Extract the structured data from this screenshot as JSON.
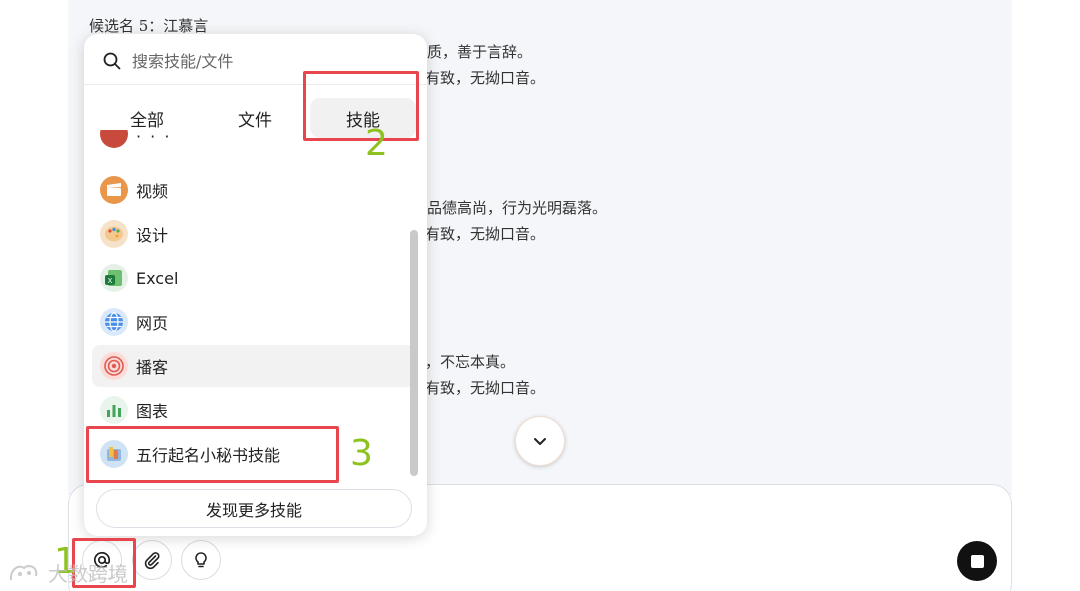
{
  "chat": {
    "lines": [
      "候选名 5：江慕言",
      "质，善于言辞。",
      "有致，无拗口音。",
      "品德高尚，行为光明磊落。",
      "有致，无拗口音。",
      "，不忘本真。",
      "有致，无拗口音。"
    ]
  },
  "popup": {
    "search_placeholder": "搜索技能/文件",
    "tabs": [
      {
        "label": "全部"
      },
      {
        "label": "文件"
      },
      {
        "label": "技能",
        "active": true
      }
    ],
    "cut_item_label": "· · ·",
    "items": [
      {
        "label": "视频",
        "icon": "video-clapper-icon"
      },
      {
        "label": "设计",
        "icon": "palette-icon"
      },
      {
        "label": "Excel",
        "icon": "excel-icon"
      },
      {
        "label": "网页",
        "icon": "globe-icon"
      },
      {
        "label": "播客",
        "icon": "podcast-icon"
      },
      {
        "label": "图表",
        "icon": "bar-chart-icon"
      },
      {
        "label": "五行起名小秘书技能",
        "icon": "app-icon"
      }
    ],
    "discover_label": "发现更多技能"
  },
  "annotations": {
    "numbers": [
      "1",
      "2",
      "3"
    ],
    "box_color": "#e8464f",
    "number_color": "#8dc21f"
  },
  "watermark": {
    "text": "大数跨境"
  }
}
